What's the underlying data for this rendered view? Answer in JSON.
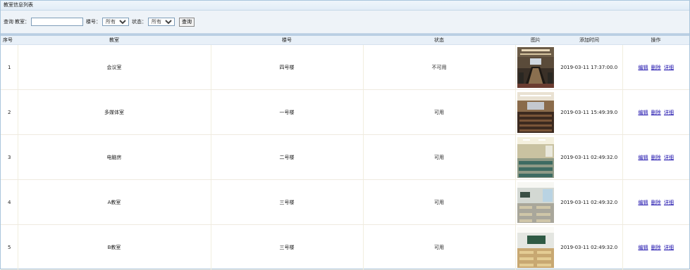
{
  "page": {
    "title": "教室信息列表"
  },
  "search": {
    "query_label": "查询",
    "classroom_label": "教室：",
    "classroom_value": "",
    "building_label": "楼号：",
    "building_selected": "所有",
    "status_label": "状态：",
    "status_selected": "所有",
    "submit_label": "查询"
  },
  "table": {
    "headers": [
      "序号",
      "教室",
      "楼号",
      "状态",
      "图片",
      "添加时间",
      "操作"
    ],
    "rows": [
      {
        "index": "1",
        "classroom": "会议室",
        "building": "四号楼",
        "status": "不可用",
        "image": "conference-room-photo",
        "added": "2019-03-11 17:37:00.0"
      },
      {
        "index": "2",
        "classroom": "多媒体室",
        "building": "一号楼",
        "status": "可用",
        "image": "lecture-hall-photo",
        "added": "2019-03-11 15:49:39.0"
      },
      {
        "index": "3",
        "classroom": "电脑房",
        "building": "二号楼",
        "status": "可用",
        "image": "computer-lab-photo",
        "added": "2019-03-11 02:49:32.0"
      },
      {
        "index": "4",
        "classroom": "A教室",
        "building": "三号楼",
        "status": "可用",
        "image": "classroom-photo",
        "added": "2019-03-11 02:49:32.0"
      },
      {
        "index": "5",
        "classroom": "B教室",
        "building": "三号楼",
        "status": "可用",
        "image": "classroom-blackboard-photo",
        "added": "2019-03-11 02:49:32.0"
      }
    ]
  },
  "actions": {
    "edit": "编辑",
    "delete": "删除",
    "detail": "详细"
  }
}
